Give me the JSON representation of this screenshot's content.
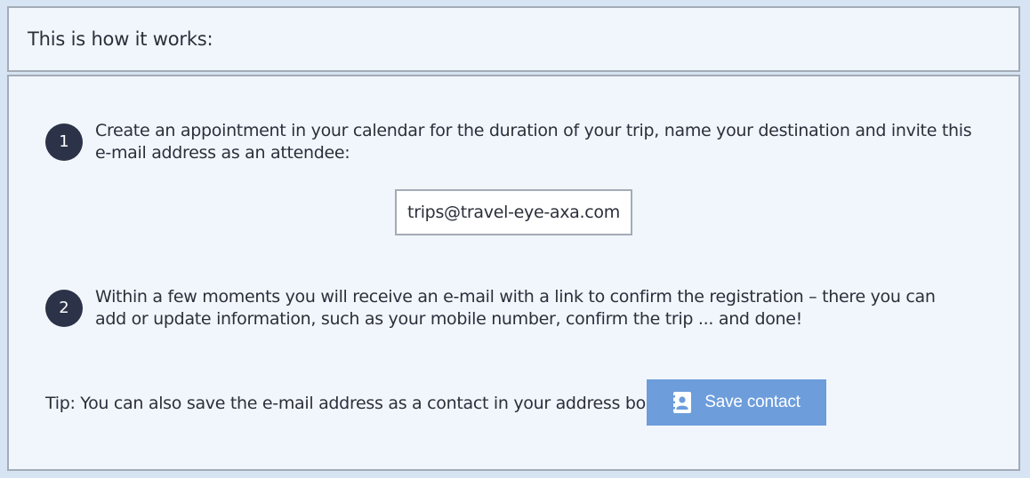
{
  "header": {
    "title": "This is how it works:"
  },
  "steps": [
    {
      "number": "1",
      "text": "Create an appointment in your calendar for the duration of your trip, name your destination and invite this e-mail address as an attendee:"
    },
    {
      "number": "2",
      "text": "Within a few moments you will receive an e-mail with a link to confirm the registration – there you can add or update information, such as your mobile number, confirm the trip ... and done!"
    }
  ],
  "email": {
    "address": "trips@travel-eye-axa.com"
  },
  "tip": {
    "text": "Tip: You can also save the e-mail address as a contact in your address book.",
    "button_label": "Save contact",
    "button_icon": "address-book-icon"
  },
  "colors": {
    "badge": "#2c3247",
    "button": "#6d9ddb",
    "panel_bg": "#f1f6fd",
    "border": "#a3abb6"
  }
}
